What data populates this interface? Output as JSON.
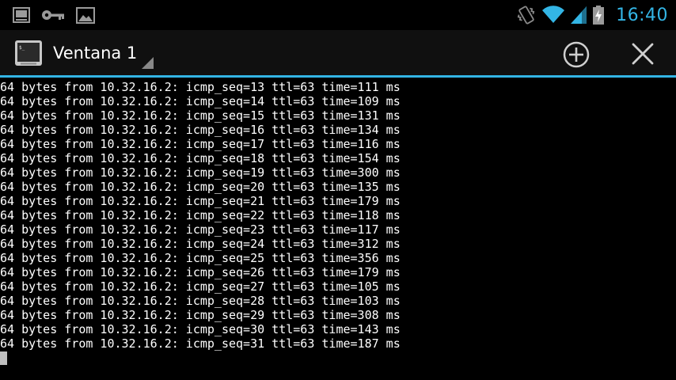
{
  "status_bar": {
    "left_icons": [
      "terminal-notification-icon",
      "key-icon",
      "image-icon"
    ],
    "right_icons": [
      "vibrate-icon",
      "wifi-icon",
      "signal-icon",
      "battery-charging-icon"
    ],
    "time": "16:40",
    "accent_color": "#33b5e5"
  },
  "action_bar": {
    "app_icon": "terminal-app-icon",
    "title": "Ventana 1",
    "add_icon": "add-window-icon",
    "close_icon": "close-window-icon",
    "divider_color": "#33b5e5"
  },
  "terminal": {
    "lines": [
      "64 bytes from 10.32.16.2: icmp_seq=13 ttl=63 time=111 ms",
      "64 bytes from 10.32.16.2: icmp_seq=14 ttl=63 time=109 ms",
      "64 bytes from 10.32.16.2: icmp_seq=15 ttl=63 time=131 ms",
      "64 bytes from 10.32.16.2: icmp_seq=16 ttl=63 time=134 ms",
      "64 bytes from 10.32.16.2: icmp_seq=17 ttl=63 time=116 ms",
      "64 bytes from 10.32.16.2: icmp_seq=18 ttl=63 time=154 ms",
      "64 bytes from 10.32.16.2: icmp_seq=19 ttl=63 time=300 ms",
      "64 bytes from 10.32.16.2: icmp_seq=20 ttl=63 time=135 ms",
      "64 bytes from 10.32.16.2: icmp_seq=21 ttl=63 time=179 ms",
      "64 bytes from 10.32.16.2: icmp_seq=22 ttl=63 time=118 ms",
      "64 bytes from 10.32.16.2: icmp_seq=23 ttl=63 time=117 ms",
      "64 bytes from 10.32.16.2: icmp_seq=24 ttl=63 time=312 ms",
      "64 bytes from 10.32.16.2: icmp_seq=25 ttl=63 time=356 ms",
      "64 bytes from 10.32.16.2: icmp_seq=26 ttl=63 time=179 ms",
      "64 bytes from 10.32.16.2: icmp_seq=27 ttl=63 time=105 ms",
      "64 bytes from 10.32.16.2: icmp_seq=28 ttl=63 time=103 ms",
      "64 bytes from 10.32.16.2: icmp_seq=29 ttl=63 time=308 ms",
      "64 bytes from 10.32.16.2: icmp_seq=30 ttl=63 time=143 ms",
      "64 bytes from 10.32.16.2: icmp_seq=31 ttl=63 time=187 ms"
    ],
    "text_color": "#ffffff",
    "cursor_color": "#bfbfbf"
  }
}
